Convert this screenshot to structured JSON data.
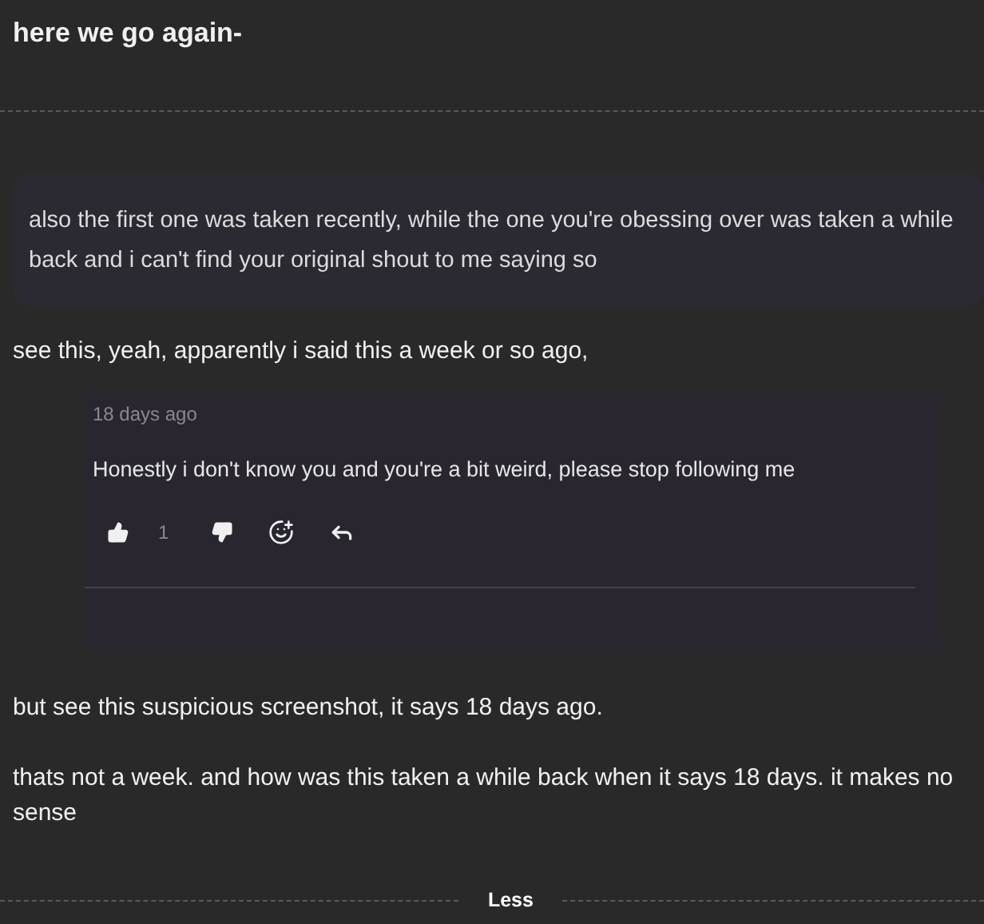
{
  "title": "here we go again-",
  "blocks": [
    {
      "kind": "quote",
      "text": "also the first one was taken recently, while the one you're obessing over was taken a while back and i can't find your original shout to me saying so"
    },
    {
      "kind": "paragraph",
      "text": "see this, yeah, apparently i said this a week or so ago,"
    },
    {
      "kind": "screenshot",
      "time": "18 days ago",
      "text": "Honestly i don't know you and you're a bit weird, please stop following me",
      "likes": "1"
    },
    {
      "kind": "paragraph",
      "text": "but see this suspicious screenshot, it says 18 days ago."
    },
    {
      "kind": "paragraph",
      "text": "thats not a week. and how was this taken a while back when it says 18 days. it makes no sense"
    }
  ],
  "toggle": {
    "label": "Less"
  }
}
